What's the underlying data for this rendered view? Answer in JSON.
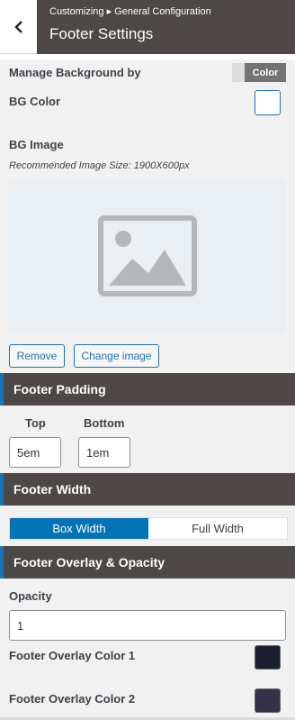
{
  "header": {
    "breadcrumb": "Customizing ▸ General Configuration",
    "title": "Footer Settings"
  },
  "background": {
    "manage_label": "Manage Background by",
    "toggle_value": "Color",
    "bg_color_label": "BG Color",
    "bg_image_label": "BG Image",
    "image_hint": "Recommended Image Size: 1900X600px",
    "remove_label": "Remove",
    "change_image_label": "Change image"
  },
  "padding": {
    "section_title": "Footer Padding",
    "top_label": "Top",
    "bottom_label": "Bottom",
    "top_value": "5em",
    "bottom_value": "1em"
  },
  "width": {
    "section_title": "Footer Width",
    "options": [
      "Box Width",
      "Full Width"
    ],
    "selected": "Box Width"
  },
  "overlay": {
    "section_title": "Footer Overlay & Opacity",
    "opacity_label": "Opacity",
    "opacity_value": "1",
    "color1_label": "Footer Overlay Color 1",
    "color2_label": "Footer Overlay Color 2",
    "color1": "#1b1f31",
    "color2": "#333249"
  },
  "colors": {
    "accent": "#2271b1",
    "header_bg": "#4d4745",
    "active_segment": "#0273b4"
  }
}
